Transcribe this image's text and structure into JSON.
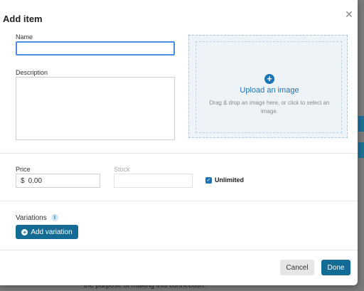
{
  "modal": {
    "title": "Add item",
    "close_icon": "close-icon"
  },
  "form": {
    "name_label": "Name",
    "name_value": "",
    "description_label": "Description",
    "description_value": "",
    "price_label": "Price",
    "price_currency": "$",
    "price_value": "0.00",
    "stock_label": "Stock",
    "stock_value": "",
    "unlimited_label": "Unlimited",
    "unlimited_checked": true
  },
  "upload": {
    "icon": "plus-circle-icon",
    "title": "Upload an image",
    "help": "Drag & drop an image here, or click to select an image."
  },
  "variations": {
    "label": "Variations",
    "info_icon": "info-icon",
    "add_button": "Add variation"
  },
  "footer": {
    "cancel": "Cancel",
    "done": "Done"
  },
  "background": {
    "partial_text": "the purpose of making this connection."
  },
  "colors": {
    "primary": "#146c94",
    "link": "#1d74b5",
    "focus_border": "#4a8fd8"
  }
}
